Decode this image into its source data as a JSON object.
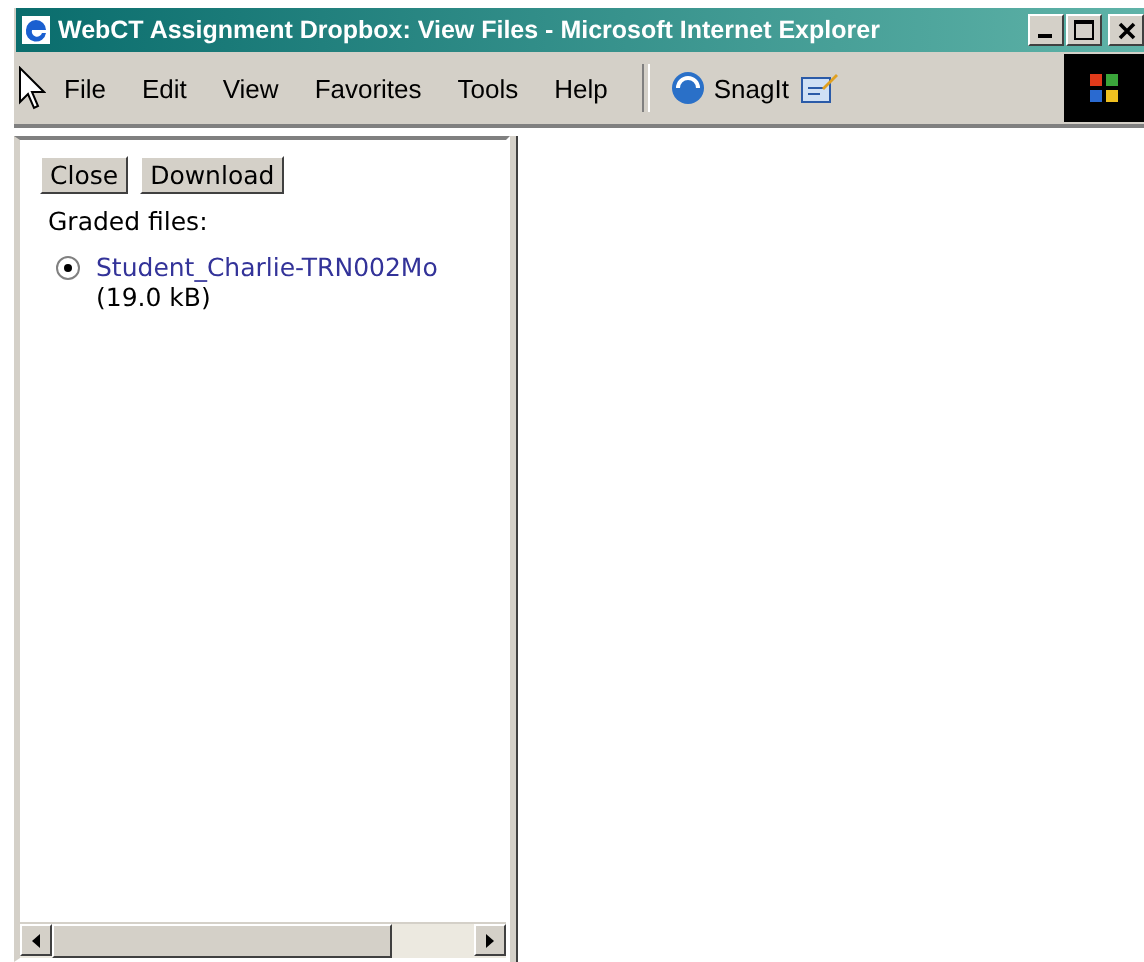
{
  "window": {
    "title": "WebCT Assignment Dropbox: View Files - Microsoft Internet Explorer"
  },
  "menu": [
    {
      "label": "File"
    },
    {
      "label": "Edit"
    },
    {
      "label": "View"
    },
    {
      "label": "Favorites"
    },
    {
      "label": "Tools"
    },
    {
      "label": "Help"
    }
  ],
  "toolbar": [
    {
      "label": "SnagIt"
    }
  ],
  "buttons": [
    "Close",
    "Download"
  ],
  "section_label": "Graded files:",
  "files": [
    {
      "name": "Student_Charlie-TRN002Mo",
      "size": "(19.0 kB)",
      "selected": true
    }
  ]
}
